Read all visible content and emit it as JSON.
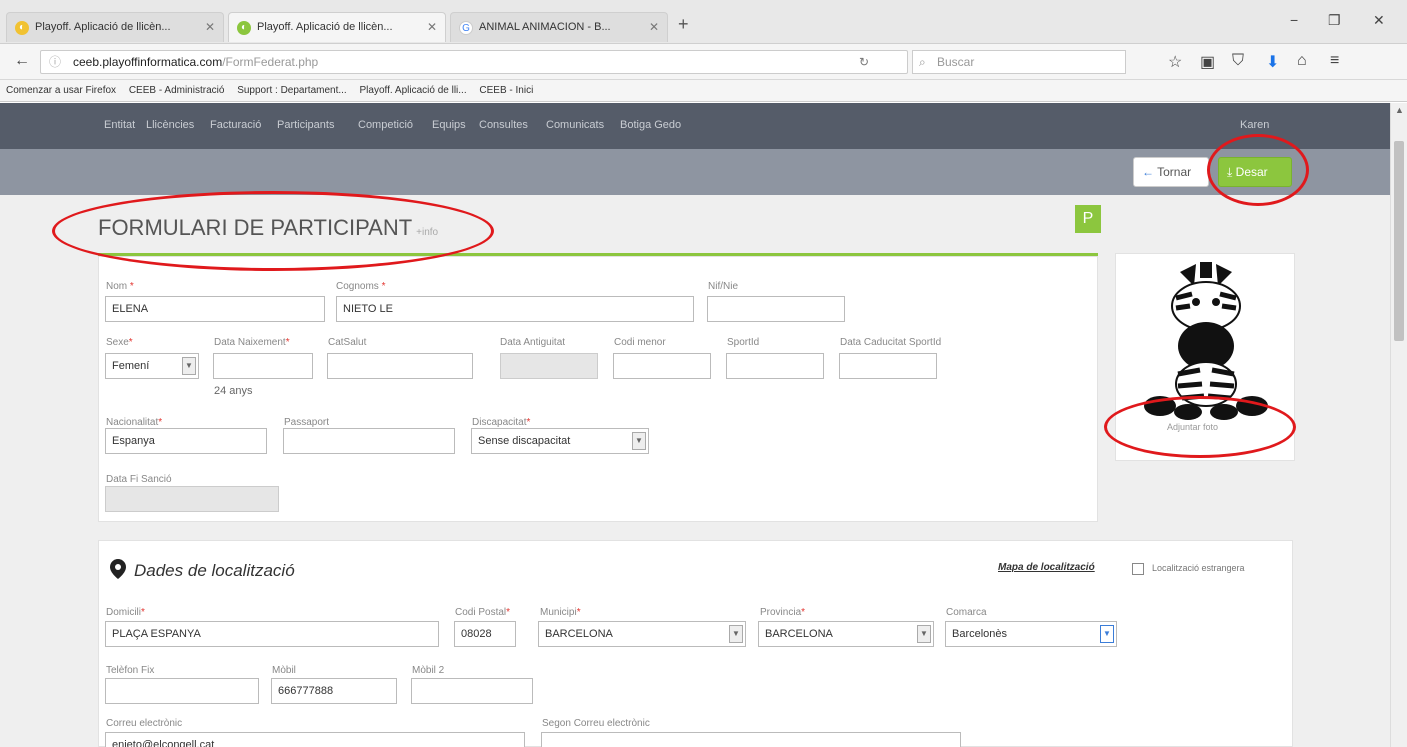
{
  "browser": {
    "tabs": [
      {
        "title": "Playoff. Aplicació de llicèn...",
        "active": false,
        "icon": "playoff-favicon"
      },
      {
        "title": "Playoff. Aplicació de llicèn...",
        "active": true,
        "icon": "playoff-favicon"
      },
      {
        "title": "ANIMAL ANIMACION - B...",
        "active": false,
        "icon": "google-favicon"
      }
    ],
    "new_tab": "+",
    "url_host": "ceeb.playoffinformatica.com",
    "url_path": "/FormFederat.php",
    "search_placeholder": "Buscar",
    "bookmarks": [
      "Comenzar a usar Firefox",
      "CEEB - Administració",
      "Support : Departament...",
      "Playoff. Aplicació de lli...",
      "CEEB - Inici"
    ]
  },
  "menu": {
    "items": [
      "Entitat",
      "Llicències",
      "Facturació",
      "Participants",
      "Competició",
      "Equips",
      "Consultes",
      "Comunicats",
      "Botiga Gedo"
    ],
    "user": "Karen"
  },
  "toolbar": {
    "back_label": "Tornar",
    "save_label": "Desar"
  },
  "form": {
    "title": "FORMULARI DE PARTICIPANT",
    "subtitle": "+info",
    "badge": "P",
    "fields": {
      "nom": {
        "label": "Nom",
        "value": "ELENA"
      },
      "cognoms": {
        "label": "Cognoms",
        "value": "NIETO LE"
      },
      "nif": {
        "label": "Nif/Nie",
        "value": ""
      },
      "sexe": {
        "label": "Sexe",
        "value": "Femení"
      },
      "data_naixement": {
        "label": "Data Naixement",
        "value": "",
        "hint": "24 anys"
      },
      "catsalut": {
        "label": "CatSalut",
        "value": ""
      },
      "data_antiguitat": {
        "label": "Data Antiguitat",
        "value": ""
      },
      "codi_menor": {
        "label": "Codi menor",
        "value": ""
      },
      "sportid": {
        "label": "SportId",
        "value": ""
      },
      "data_caducitat": {
        "label": "Data Caducitat SportId",
        "value": ""
      },
      "nacionalitat": {
        "label": "Nacionalitat",
        "value": "Espanya"
      },
      "passaport": {
        "label": "Passaport",
        "value": ""
      },
      "discapacitat": {
        "label": "Discapacitat",
        "value": "Sense discapacitat"
      },
      "data_fi_sancio": {
        "label": "Data Fi Sanció",
        "value": ""
      }
    },
    "photo_label": "Adjuntar foto"
  },
  "location": {
    "title": "Dades de localització",
    "map_link": "Mapa de localització",
    "foreign_label": "Localització estrangera",
    "fields": {
      "domicili": {
        "label": "Domicili",
        "value": "PLAÇA ESPANYA"
      },
      "codi_postal": {
        "label": "Codi Postal",
        "value": "08028"
      },
      "municipi": {
        "label": "Municipi",
        "value": "BARCELONA"
      },
      "provincia": {
        "label": "Provincia",
        "value": "BARCELONA"
      },
      "comarca": {
        "label": "Comarca",
        "value": "Barcelonès"
      },
      "telefon_fix": {
        "label": "Telèfon Fix",
        "value": ""
      },
      "mobil": {
        "label": "Mòbil",
        "value": "666777888"
      },
      "mobil2": {
        "label": "Mòbil 2",
        "value": ""
      },
      "correu": {
        "label": "Correu electrònic",
        "value": "enieto@elcongell.cat"
      },
      "segon_correu": {
        "label": "Segon Correu electrònic",
        "value": ""
      }
    }
  },
  "colors": {
    "accent": "#8cc63e",
    "menu_bg": "#555c69",
    "subbar_bg": "#8e95a1",
    "annotation": "#e0191c"
  }
}
